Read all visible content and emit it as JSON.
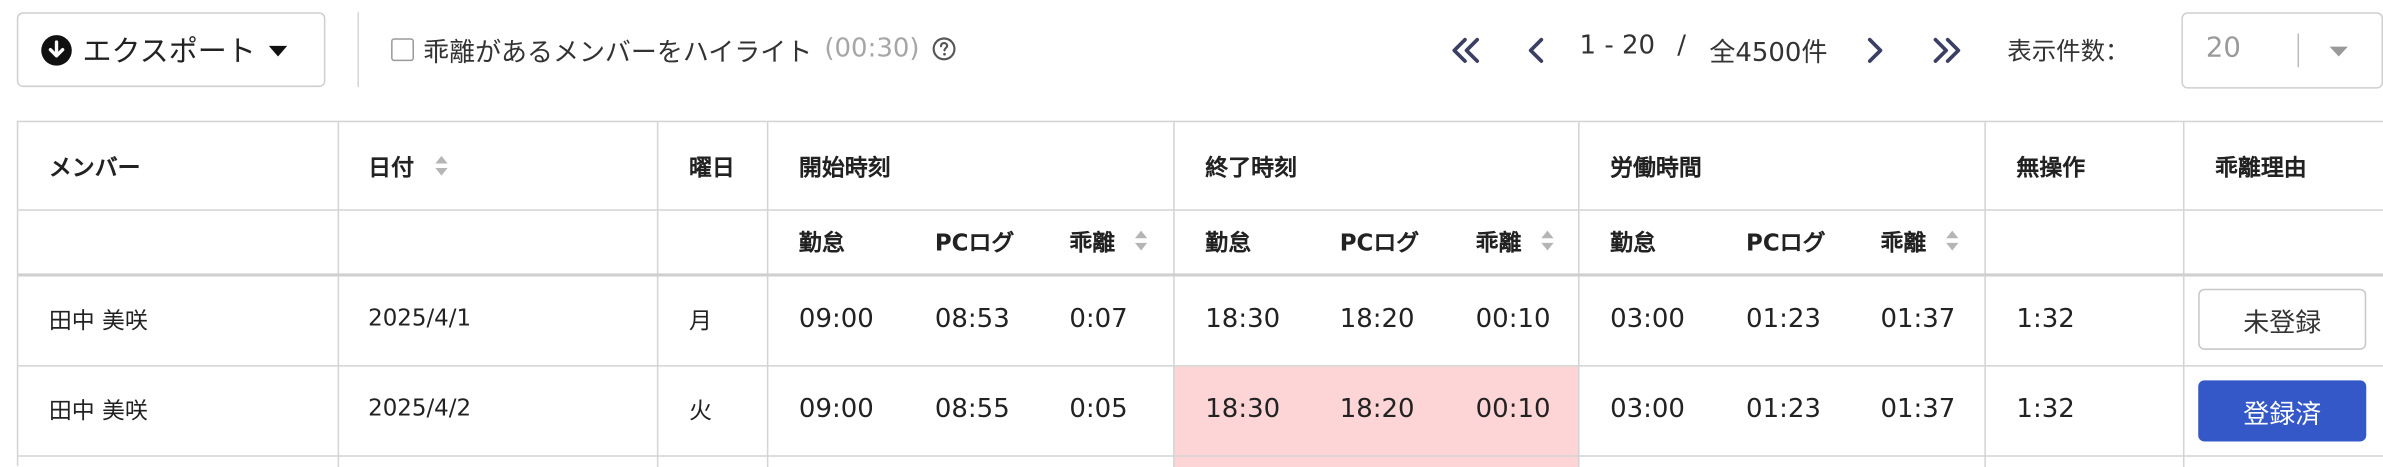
{
  "toolbar": {
    "export_label": "エクスポート",
    "highlight_label": "乖離があるメンバーをハイライト",
    "highlight_time": "(00:30)",
    "highlight_checked": false
  },
  "pagination": {
    "range": "1 - 20",
    "separator": "/",
    "total": "全4500件",
    "per_page_label": "表示件数：",
    "per_page_value": "20"
  },
  "table": {
    "headers": {
      "member": "メンバー",
      "date": "日付",
      "weekday": "曜日",
      "start": "開始時刻",
      "end": "終了時刻",
      "work": "労働時間",
      "idle": "無操作",
      "reason": "乖離理由"
    },
    "subheaders": {
      "attendance": "勤怠",
      "pclog": "PCログ",
      "gap": "乖離"
    },
    "rows": [
      {
        "member": "田中 美咲",
        "date": "2025/4/1",
        "weekday": "月",
        "start_att": "09:00",
        "start_pc": "08:53",
        "start_gap": "0:07",
        "end_att": "18:30",
        "end_pc": "18:20",
        "end_gap": "00:10",
        "work_att": "03:00",
        "work_pc": "01:23",
        "work_gap": "01:37",
        "idle": "1:32",
        "reason": "未登録",
        "reason_state": "unregistered",
        "end_highlight": false
      },
      {
        "member": "田中 美咲",
        "date": "2025/4/2",
        "weekday": "火",
        "start_att": "09:00",
        "start_pc": "08:55",
        "start_gap": "0:05",
        "end_att": "18:30",
        "end_pc": "18:20",
        "end_gap": "00:10",
        "work_att": "03:00",
        "work_pc": "01:23",
        "work_gap": "01:37",
        "idle": "1:32",
        "reason": "登録済",
        "reason_state": "registered",
        "end_highlight": true
      }
    ]
  },
  "colors": {
    "highlight": "#fdd5d7",
    "registered_button": "#3558c8",
    "border": "#d4d4d4"
  }
}
